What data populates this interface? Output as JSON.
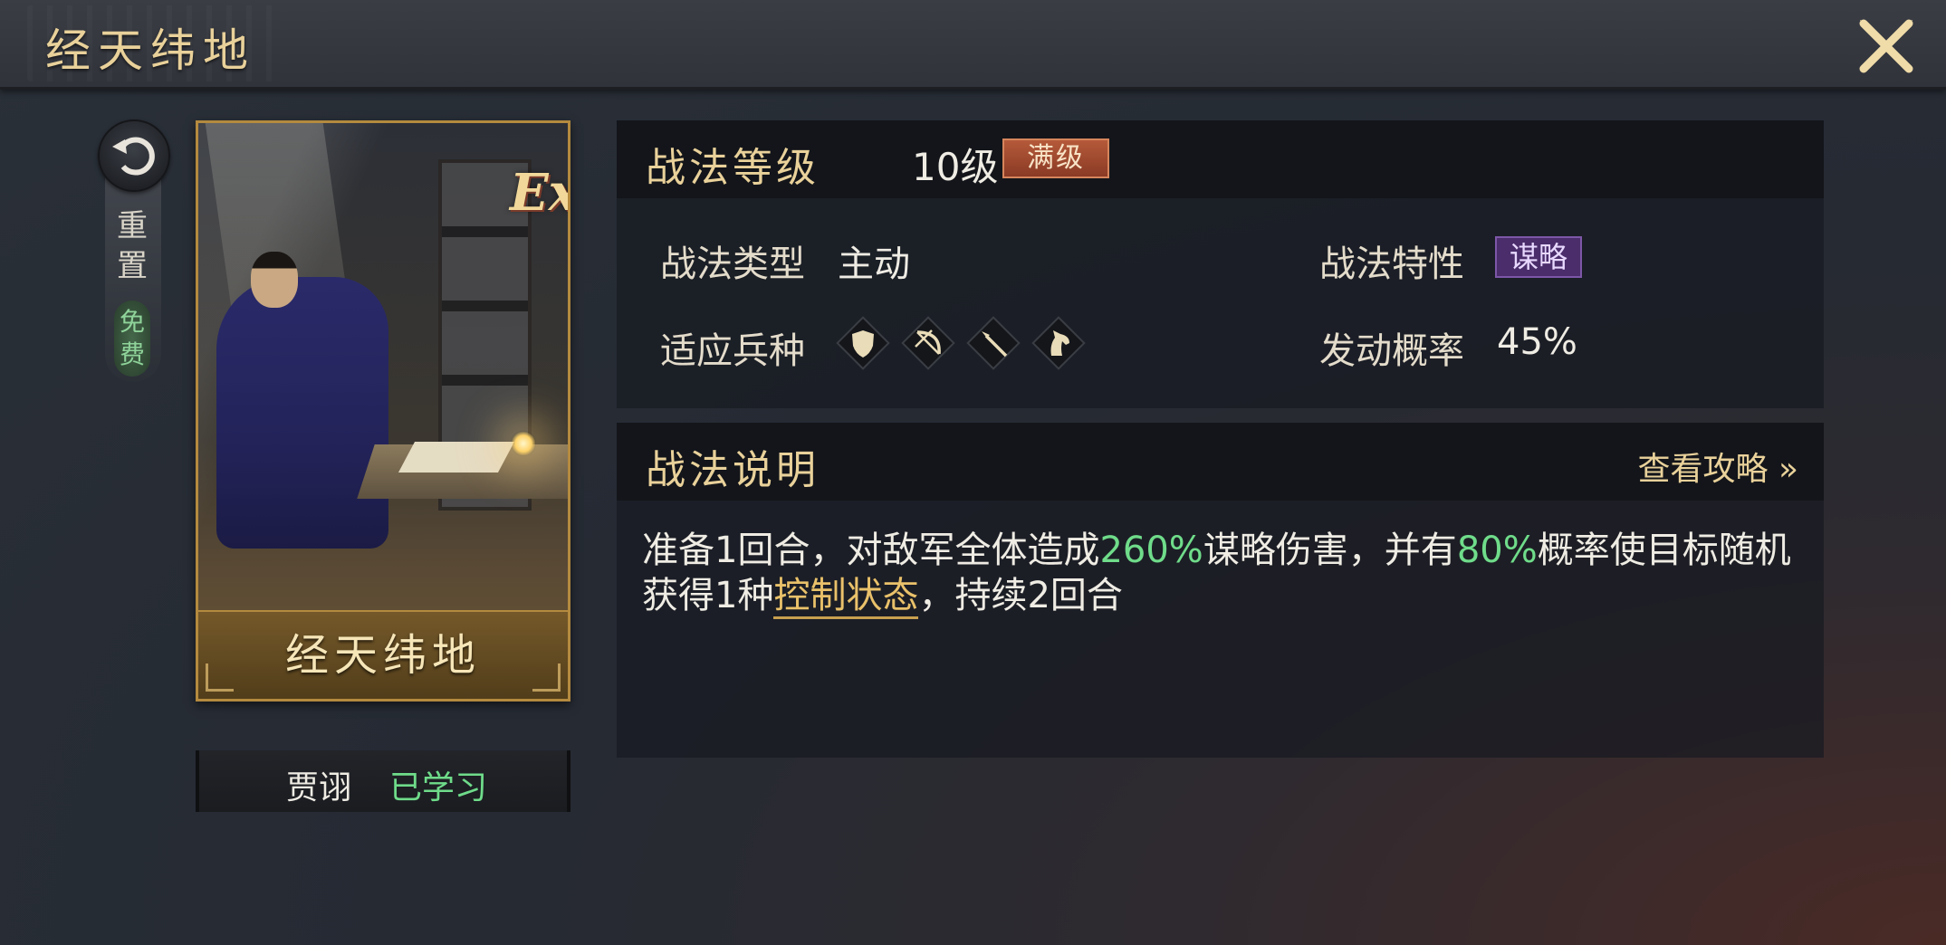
{
  "header": {
    "title": "经天纬地"
  },
  "reset": {
    "label": "重置",
    "free_label": "免费"
  },
  "card": {
    "badge": "Ex",
    "name": "经天纬地"
  },
  "owner": {
    "name": "贾诩",
    "status": "已学习"
  },
  "level_panel": {
    "title": "战法等级",
    "level": "10级",
    "max_badge": "满级",
    "type_label": "战法类型",
    "type_value": "主动",
    "trait_label": "战法特性",
    "trait_value": "谋略",
    "units_label": "适应兵种",
    "units": [
      "shield-icon",
      "bow-icon",
      "spear-icon",
      "horse-icon"
    ],
    "rate_label": "发动概率",
    "rate_value": "45%"
  },
  "desc_panel": {
    "title": "战法说明",
    "guide_link": "查看攻略",
    "text_1": "准备1回合，对敌军全体造成",
    "hl_1": "260%",
    "text_2": "谋略伤害，并有",
    "hl_2": "80%",
    "text_3": "概率使目标随机获得1种",
    "link_term": "控制状态",
    "text_4": "，持续2回合"
  },
  "colors": {
    "gold": "#e9d19a",
    "green": "#6fdc8a",
    "purple_badge": "#4a2d6a",
    "max_badge": "#b55a3a"
  }
}
